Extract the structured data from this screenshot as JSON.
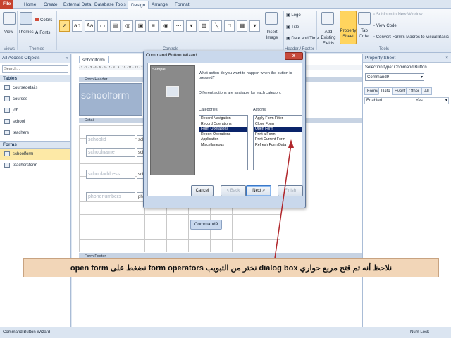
{
  "ribbon": {
    "tabs": [
      "File",
      "Home",
      "Create",
      "External Data",
      "Database Tools",
      "Design",
      "Arrange",
      "Format"
    ],
    "groups": {
      "views": {
        "label": "Views",
        "view_label": "View"
      },
      "themes": {
        "label": "Themes",
        "themes_label": "Themes",
        "colors_label": "Colors",
        "fonts_label": "Fonts"
      },
      "controls": {
        "label": "Controls",
        "insert_image_label": "Insert Image"
      },
      "header_footer": {
        "label": "Header / Footer",
        "logo_label": "Logo",
        "title_label": "Title",
        "date_time_label": "Date and Time"
      },
      "tools": {
        "label": "Tools",
        "add_fields_label": "Add Existing Fields",
        "property_sheet_label": "Property Sheet",
        "tab_order_label": "Tab Order",
        "subform_label": "Subform in New Window",
        "view_code_label": "View Code",
        "convert_label": "Convert Form's Macros to Visual Basic"
      }
    }
  },
  "nav": {
    "title": "All Access Objects",
    "search_placeholder": "Search...",
    "sections": [
      {
        "label": "Tables",
        "items": [
          "coursedetails",
          "courses",
          "job",
          "school",
          "teachers"
        ]
      },
      {
        "label": "Forms",
        "items": [
          "schoolform",
          "teachersform"
        ]
      }
    ]
  },
  "document": {
    "tab_label": "schoolform",
    "form_header_label": "Form Header",
    "header_title": "schoolform",
    "detail_label": "Detail",
    "form_footer_label": "Form Footer",
    "fields": [
      {
        "label": "schoolid",
        "control": "scho"
      },
      {
        "label": "schoolname",
        "control": "scho"
      },
      {
        "label": "schooladdress",
        "control": "scho"
      },
      {
        "label": "phonenumbers",
        "control": "pho"
      }
    ],
    "command_button_label": "Command9"
  },
  "property_sheet": {
    "title": "Property Sheet",
    "selection_type": "Selection type:  Command Button",
    "selected_object": "Command9",
    "tabs": [
      "Format",
      "Data",
      "Event",
      "Other",
      "All"
    ],
    "active_tab": "Data",
    "row_name": "Enabled",
    "row_value": "Yes"
  },
  "dialog": {
    "title": "Command Button Wizard",
    "close_label": "x",
    "sample_label": "Sample:",
    "question": "What action do you want to happen when the button is pressed?",
    "hint": "Different actions are available for each category.",
    "categories_label": "Categories:",
    "actions_label": "Actions:",
    "categories": [
      "Record Navigation",
      "Record Operations",
      "Form Operations",
      "Report Operations",
      "Application",
      "Miscellaneous"
    ],
    "selected_category": "Form Operations",
    "actions": [
      "Apply Form Filter",
      "Close Form",
      "Open Form",
      "Print a Form",
      "Print Current Form",
      "Refresh Form Data"
    ],
    "selected_action": "Open Form",
    "buttons": {
      "cancel": "Cancel",
      "back": "< Back",
      "next": "Next >",
      "finish": "Finish"
    }
  },
  "callout": {
    "text": "نلاحظ أنه تم فتح مربع حواري dialog box نختر من التبويب form operators نضغط على open form"
  },
  "status": {
    "left": "Command Button Wizard",
    "right": "Num Lock"
  },
  "colors": {
    "accent": "#c6422e",
    "selection": "#0a246a",
    "callout_bg": "#f2d6b8",
    "arrow": "#b0262b"
  }
}
